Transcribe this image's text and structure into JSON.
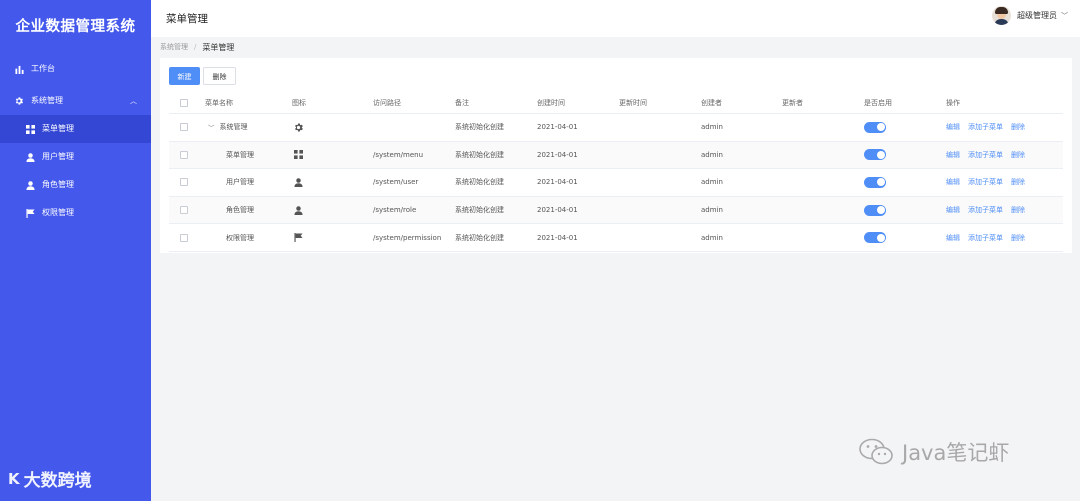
{
  "app": {
    "title": "企业数据管理系统"
  },
  "colors": {
    "sidebar": "#4458ec",
    "sidebar_active": "#3447d4",
    "primary": "#4f8ef7"
  },
  "sidebar": {
    "items": [
      {
        "label": "工作台",
        "icon": "bar-chart-icon"
      },
      {
        "label": "系统管理",
        "icon": "gear-icon",
        "expanded": true
      },
      {
        "label": "菜单管理",
        "icon": "grid-icon",
        "active": true
      },
      {
        "label": "用户管理",
        "icon": "user-icon"
      },
      {
        "label": "角色管理",
        "icon": "user-icon"
      },
      {
        "label": "权限管理",
        "icon": "flag-icon"
      }
    ]
  },
  "header": {
    "title": "菜单管理",
    "user_name": "超级管理员"
  },
  "breadcrumb": {
    "parent": "系统管理",
    "separator": "/",
    "current": "菜单管理"
  },
  "toolbar": {
    "new_label": "新建",
    "delete_label": "删除"
  },
  "table": {
    "columns": [
      "菜单名称",
      "图标",
      "访问路径",
      "备注",
      "创建时间",
      "更新时间",
      "创建者",
      "更新者",
      "是否启用",
      "操作"
    ],
    "rows": [
      {
        "name": "系统管理",
        "icon": "gear-icon",
        "path": "",
        "remark": "系统初始化创建",
        "created": "2021-04-01",
        "updated": "",
        "creator": "admin",
        "updater": "",
        "enabled": true,
        "parent": true
      },
      {
        "name": "菜单管理",
        "icon": "grid-icon",
        "path": "/system/menu",
        "remark": "系统初始化创建",
        "created": "2021-04-01",
        "updated": "",
        "creator": "admin",
        "updater": "",
        "enabled": true
      },
      {
        "name": "用户管理",
        "icon": "user-icon",
        "path": "/system/user",
        "remark": "系统初始化创建",
        "created": "2021-04-01",
        "updated": "",
        "creator": "admin",
        "updater": "",
        "enabled": true
      },
      {
        "name": "角色管理",
        "icon": "user-icon",
        "path": "/system/role",
        "remark": "系统初始化创建",
        "created": "2021-04-01",
        "updated": "",
        "creator": "admin",
        "updater": "",
        "enabled": true
      },
      {
        "name": "权限管理",
        "icon": "flag-icon",
        "path": "/system/permission",
        "remark": "系统初始化创建",
        "created": "2021-04-01",
        "updated": "",
        "creator": "admin",
        "updater": "",
        "enabled": true
      }
    ],
    "actions": {
      "edit": "编辑",
      "add_child": "添加子菜单",
      "delete": "删除"
    }
  },
  "watermarks": {
    "left": "大数跨境",
    "left_logo": "K",
    "right": "Java笔记虾"
  }
}
